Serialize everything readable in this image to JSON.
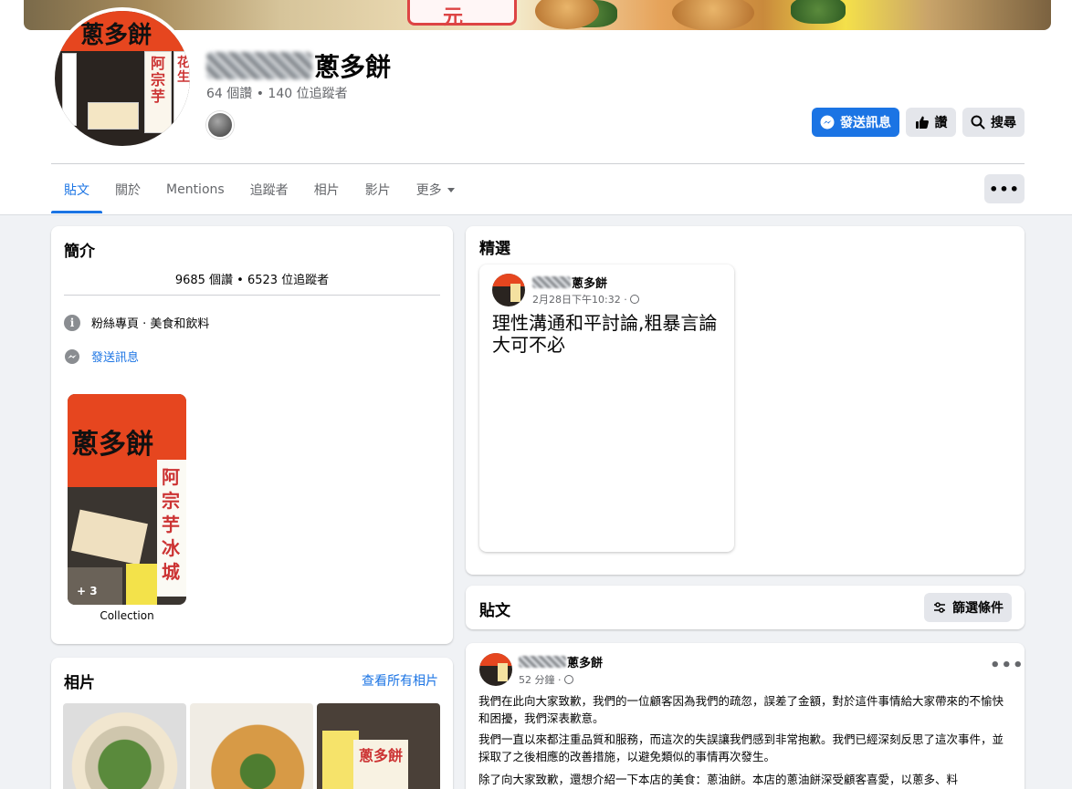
{
  "page": {
    "name": "蔥多餅",
    "stats": "64 個讚 • 140 位追蹤者"
  },
  "actions": {
    "message": "發送訊息",
    "like": "讚",
    "search": "搜尋"
  },
  "tabs": [
    {
      "label": "貼文",
      "active": true
    },
    {
      "label": "關於"
    },
    {
      "label": "Mentions"
    },
    {
      "label": "追蹤者"
    },
    {
      "label": "相片"
    },
    {
      "label": "影片"
    },
    {
      "label": "更多"
    }
  ],
  "intro": {
    "title": "簡介",
    "stats": "9685 個讚 • 6523 位追蹤者",
    "category": "粉絲專頁 · 美食和飲料",
    "message_link": "發送訊息",
    "collection_count": "+ 3",
    "collection_label": "Collection"
  },
  "photos": {
    "title": "相片",
    "see_all": "查看所有相片"
  },
  "featured": {
    "title": "精選",
    "author": "蔥多餅",
    "time": "2月28日下午10:32 ·",
    "text": "理性溝通和平討論,粗暴言論大可不必"
  },
  "posts": {
    "title": "貼文",
    "filter": "篩選條件",
    "author": "蔥多餅",
    "time": "52 分鐘 ·",
    "paragraphs": [
      "我們在此向大家致歉，我們的一位顧客因為我們的疏忽，誤差了金額，對於這件事情給大家帶來的不愉快和困擾，我們深表歉意。",
      "我們一直以來都注重品質和服務，而這次的失誤讓我們感到非常抱歉。我們已經深刻反思了這次事件，並採取了之後相應的改善措施，以避免類似的事情再次發生。",
      "除了向大家致歉，還想介紹一下本店的美食：蔥油餅。本店的蔥油餅深受顧客喜愛，以蔥多、料"
    ]
  },
  "colors": {
    "accent": "#1b74e4",
    "background": "#f0f2f5",
    "secondary_text": "#65676b"
  }
}
